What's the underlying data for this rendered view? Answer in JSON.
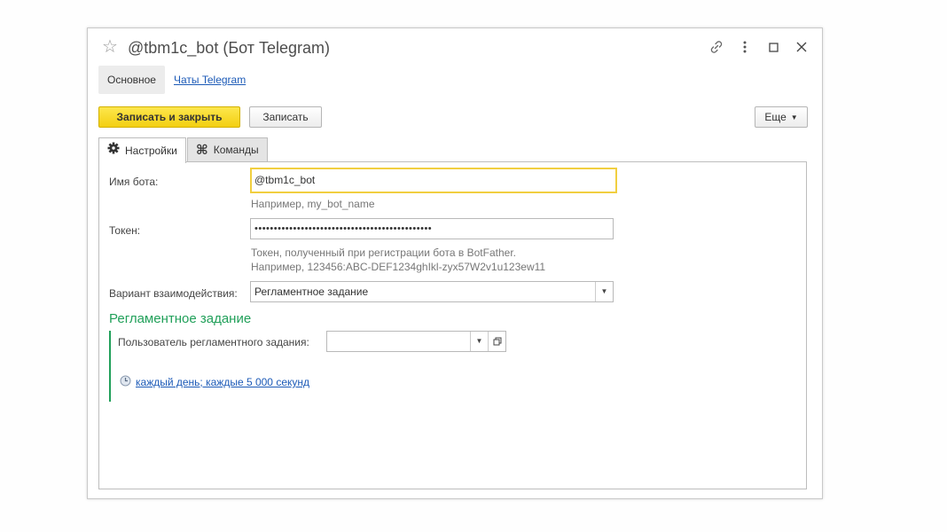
{
  "window": {
    "title": "@tbm1c_bot (Бот Telegram)"
  },
  "nav": {
    "main": "Основное",
    "link": "Чаты Telegram"
  },
  "toolbar": {
    "save_close": "Записать и закрыть",
    "save": "Записать",
    "more": "Еще"
  },
  "tabs": [
    {
      "label": "Настройки",
      "icon": "gear-icon"
    },
    {
      "label": "Команды",
      "icon": "command-icon"
    }
  ],
  "form": {
    "bot_name_label": "Имя бота:",
    "bot_name_value": "@tbm1c_bot",
    "bot_name_hint": "Например, my_bot_name",
    "token_label": "Токен:",
    "token_value": "••••••••••••••••••••••••••••••••••••••••••••••",
    "token_hint_1": "Токен, полученный при регистрации бота в BotFather.",
    "token_hint_2": "Например, 123456:ABC-DEF1234ghIkl-zyx57W2v1u123ew11",
    "variant_label": "Вариант взаимодействия:",
    "variant_value": "Регламентное задание"
  },
  "schedule_group": {
    "title": "Регламентное задание",
    "user_label": "Пользователь регламентного задания:",
    "user_value": "",
    "schedule_link": "каждый день; каждые 5 000 секунд"
  },
  "colors": {
    "accent_yellow": "#f3cf10",
    "link_blue": "#1c5ab7",
    "group_green": "#21a05a"
  }
}
